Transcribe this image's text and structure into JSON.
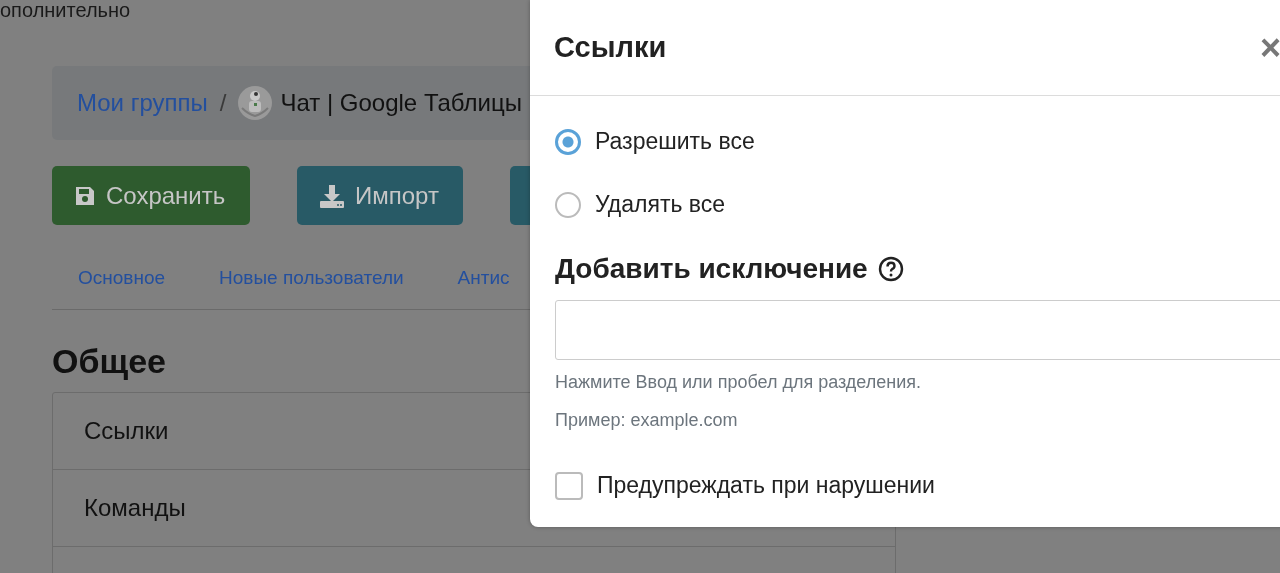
{
  "background_page": {
    "header_text": "ополнительно",
    "breadcrumb": [
      {
        "kind": "link",
        "text": "Мои группы"
      },
      {
        "kind": "separator",
        "text": "/"
      },
      {
        "kind": "current",
        "text": "Чат | Google Таблицы"
      }
    ],
    "buttons": [
      {
        "kind": "save",
        "label": "Сохранить"
      },
      {
        "kind": "import",
        "label": "Импорт"
      },
      {
        "kind": "other"
      }
    ],
    "tabs": [
      {
        "label": "Основное"
      },
      {
        "label": "Новые пользователи"
      },
      {
        "label": "Антис"
      }
    ],
    "section_title": "Общее",
    "list_items": [
      {
        "label": "Ссылки"
      },
      {
        "label": "Команды"
      }
    ]
  },
  "modal": {
    "title": "Ссылки",
    "close": "×",
    "options": [
      {
        "label": "Разрешить все",
        "selected": true
      },
      {
        "label": "Удалять все",
        "selected": false
      }
    ],
    "exception_title": "Добавить исключение",
    "help_texts": [
      "Нажмите Ввод или пробел для разделения.",
      "Пример: example.com"
    ],
    "checkbox": {
      "label": "Предупреждать при нарушении",
      "checked": false
    }
  }
}
